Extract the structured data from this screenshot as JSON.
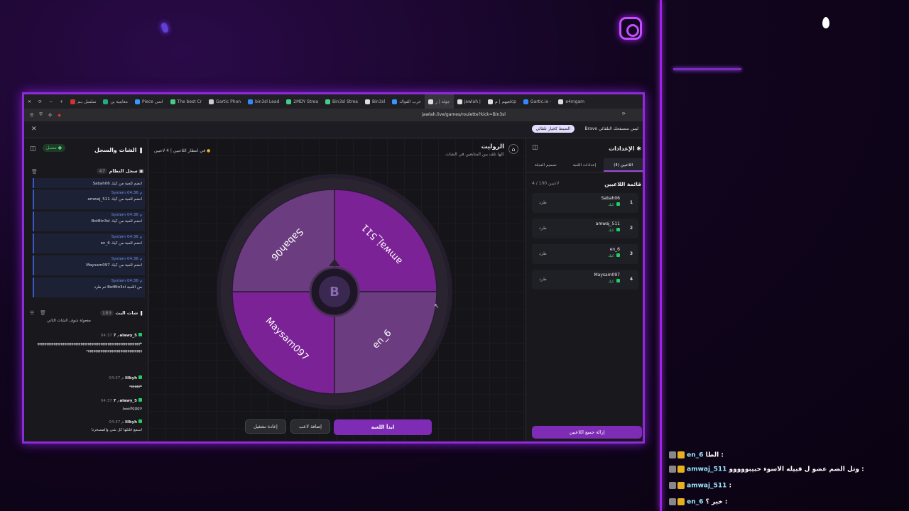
{
  "browser": {
    "tabs": [
      "سلسل بـم",
      "معاينية بن",
      "Piece انمي",
      "The best Cr",
      "Gartic Phon",
      "bin3sl Lead",
      "2MDY Strea",
      "Bin3sl Strea",
      "Bin3sl",
      "حرب الفواك",
      "جولة | ر",
      "jawlah |",
      "لعيهم | مcp",
      "Gartic.io -",
      "e4mgam"
    ],
    "url": "jawlah.live/games/roulette?kick=Bin3sl",
    "notif_message": "Brave ليس متصفحك التلقائي",
    "notif_button": "الضبط كخيار تلقائي"
  },
  "left": {
    "header": "الشات والسجل",
    "connected": "متصل",
    "system_log": "سجل النظام",
    "system_count": "47",
    "system_items": [
      {
        "meta": "",
        "text": "Sabah06 انضم للعبة من كيك"
      },
      {
        "meta": "System 04:36 م",
        "text": "amwaj_511 انضم للعبة من كيك"
      },
      {
        "meta": "System 04:36 م",
        "text": "BotBin3sl انضم للعبة من كيك"
      },
      {
        "meta": "System 04:36 م",
        "text": "en_6 انضم للعبة من كيك"
      },
      {
        "meta": "System 04:36 م",
        "text": "Maysam097 انضم للعبة من كيك"
      },
      {
        "meta": "System 04:36 م",
        "text": "تم طرد BotBin3sl من اللعبة"
      }
    ],
    "live_chat": "شات البث",
    "live_count": "183",
    "chat_top": "مفعولة شوف الشات الثاني",
    "chat_items": [
      {
        "name": "7alawy_5",
        "time": "04:37 م",
        "text": "ههههههههههههههههههههههههههههههههههههههههههههههههههههههههههههههههههههههههههههههههههههههههه"
      },
      {
        "name": "lilkyh",
        "time": "04:37 م",
        "text": "ههههههه"
      },
      {
        "name": "7alawy_5",
        "time": "04:37 م",
        "text": "القفطgggo"
      },
      {
        "name": "lilkyh",
        "time": "04:37 م",
        "text": "اسمع قلتلها كل شي والمسخرتا"
      }
    ]
  },
  "center": {
    "title": "الروليت",
    "subtitle": "كلها تلف بين المتابعين في الشات",
    "status": "في انتظار اللاعبين",
    "players_count": "4 لاعبين",
    "segments": [
      {
        "name": "amwaj_511",
        "color": "#7b2296"
      },
      {
        "name": "en_6",
        "color": "#6b3d80"
      },
      {
        "name": "Maysam097",
        "color": "#7b2296"
      },
      {
        "name": "Sabah06",
        "color": "#6b3d80"
      }
    ],
    "start_button": "ابدأ اللعبة",
    "add_player_button": "إضافة لاعب",
    "restart_button": "إعادة تشغيل"
  },
  "right": {
    "header": "الإعدادات",
    "tabs": [
      "اللاعبين (4)",
      "إعدادات اللعبة",
      "تصميم العجلة"
    ],
    "list_title": "قائمة اللاعبين",
    "list_count": "4 / 100 لاعبين",
    "kick_label": "طرد",
    "ready_label": "كيك",
    "players": [
      {
        "num": "1",
        "name": "Sabah06"
      },
      {
        "num": "2",
        "name": "amwaj_511"
      },
      {
        "num": "3",
        "name": "en_6"
      },
      {
        "num": "4",
        "name": "Maysam097"
      }
    ],
    "remove_all_button": "إزالة جميع اللاعبين"
  },
  "stream_chat": [
    {
      "user": "en_6",
      "text": "الطا :"
    },
    {
      "user": "amwaj_511",
      "text": "وتل الضم عضو ل قبيله الاسوء حبيبووووو :"
    },
    {
      "user": "amwaj_511",
      "text": ":"
    },
    {
      "user": "en_6",
      "text": "خير ؟ :"
    }
  ],
  "colors": {
    "accent": "#8d2bd6",
    "button": "#7e2bb6",
    "wheel_dark": "#7b2296",
    "wheel_light": "#6b3d80"
  }
}
